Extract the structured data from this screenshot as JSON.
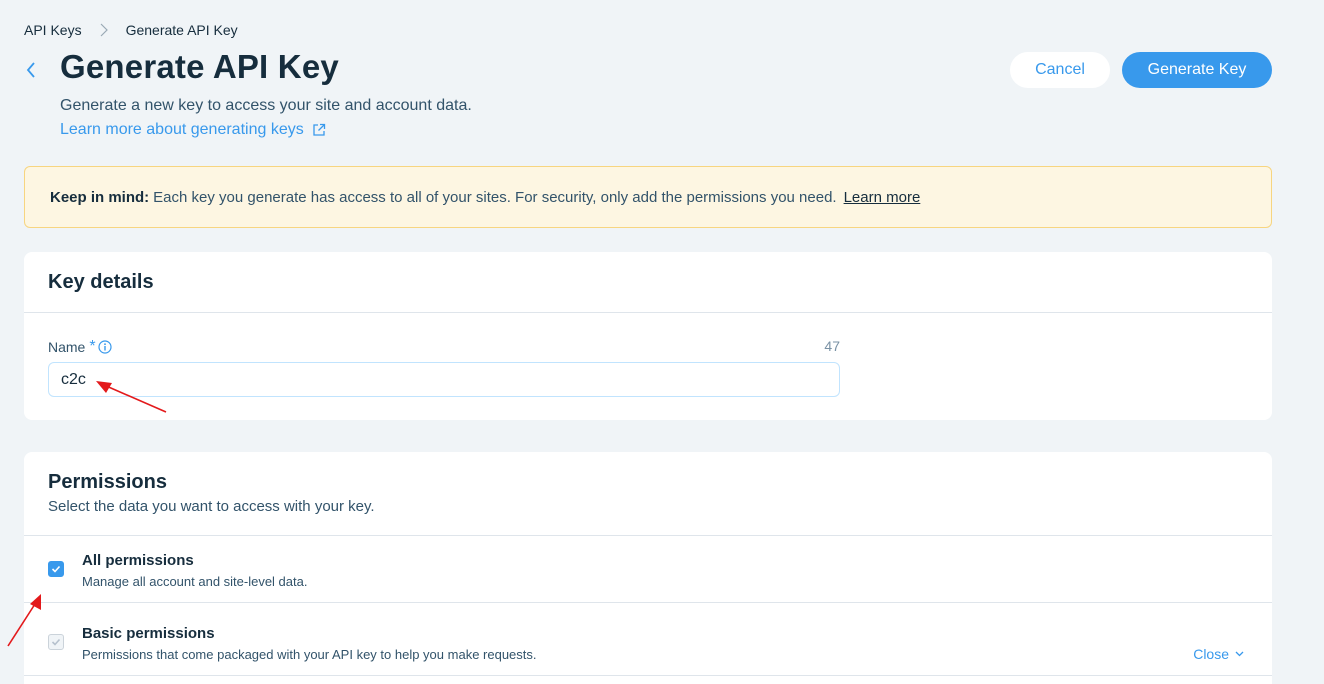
{
  "breadcrumb": {
    "parent": "API Keys",
    "current": "Generate API Key"
  },
  "header": {
    "title": "Generate API Key",
    "subtitle": "Generate a new key to access your site and account data.",
    "learn_link": "Learn more about generating keys",
    "cancel_label": "Cancel",
    "generate_label": "Generate Key"
  },
  "notice": {
    "bold": "Keep in mind:",
    "text": "Each key you generate has access to all of your sites. For security, only add the permissions you need.",
    "link": "Learn more"
  },
  "key_details": {
    "title": "Key details",
    "name_label": "Name",
    "required_mark": "*",
    "char_count": "47",
    "name_value": "c2c"
  },
  "permissions": {
    "title": "Permissions",
    "subtitle": "Select the data you want to access with your key.",
    "items": [
      {
        "name": "All permissions",
        "description": "Manage all account and site-level data.",
        "checked": true
      },
      {
        "name": "Basic permissions",
        "description": "Permissions that come packaged with your API key to help you make requests.",
        "checked": true,
        "toggle_label": "Close"
      }
    ]
  },
  "colors": {
    "accent": "#3899ec",
    "notice_bg": "#fdf6e2",
    "annotation_arrow": "#e3191b"
  }
}
